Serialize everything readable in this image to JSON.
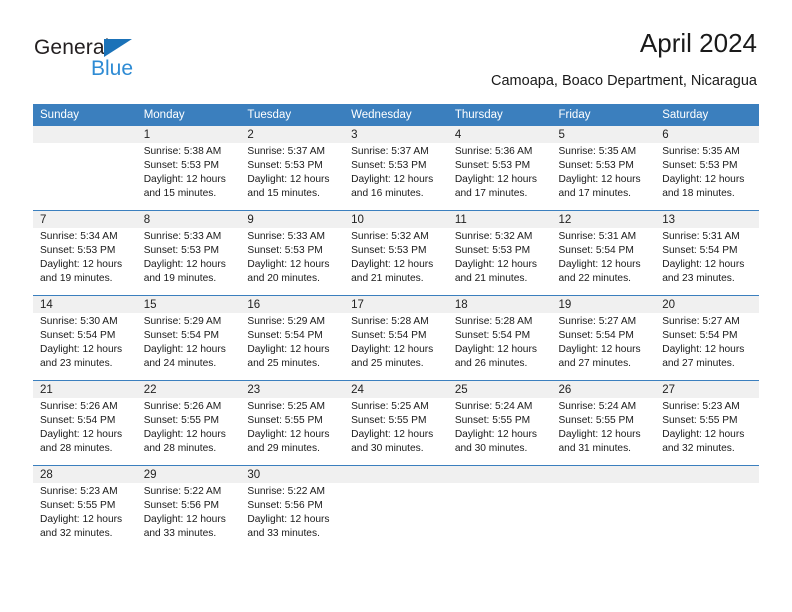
{
  "brand": {
    "name_part1": "General",
    "name_part2": "Blue",
    "triangle_icon": "triangle-icon",
    "accent_dark": "#1b72b8",
    "accent_light": "#2e8bd4"
  },
  "header": {
    "title": "April 2024",
    "subtitle": "Camoapa, Boaco Department, Nicaragua"
  },
  "colors": {
    "header_row_bg": "#3b7fbe",
    "daynum_bg": "#f0f0f0",
    "grid_line": "#3b7fbe",
    "text": "#1a1a1a"
  },
  "calendar": {
    "weekday_headers": [
      "Sunday",
      "Monday",
      "Tuesday",
      "Wednesday",
      "Thursday",
      "Friday",
      "Saturday"
    ],
    "weeks": [
      [
        {
          "day": "",
          "sunrise": "",
          "sunset": "",
          "daylight1": "",
          "daylight2": ""
        },
        {
          "day": "1",
          "sunrise": "Sunrise: 5:38 AM",
          "sunset": "Sunset: 5:53 PM",
          "daylight1": "Daylight: 12 hours",
          "daylight2": "and 15 minutes."
        },
        {
          "day": "2",
          "sunrise": "Sunrise: 5:37 AM",
          "sunset": "Sunset: 5:53 PM",
          "daylight1": "Daylight: 12 hours",
          "daylight2": "and 15 minutes."
        },
        {
          "day": "3",
          "sunrise": "Sunrise: 5:37 AM",
          "sunset": "Sunset: 5:53 PM",
          "daylight1": "Daylight: 12 hours",
          "daylight2": "and 16 minutes."
        },
        {
          "day": "4",
          "sunrise": "Sunrise: 5:36 AM",
          "sunset": "Sunset: 5:53 PM",
          "daylight1": "Daylight: 12 hours",
          "daylight2": "and 17 minutes."
        },
        {
          "day": "5",
          "sunrise": "Sunrise: 5:35 AM",
          "sunset": "Sunset: 5:53 PM",
          "daylight1": "Daylight: 12 hours",
          "daylight2": "and 17 minutes."
        },
        {
          "day": "6",
          "sunrise": "Sunrise: 5:35 AM",
          "sunset": "Sunset: 5:53 PM",
          "daylight1": "Daylight: 12 hours",
          "daylight2": "and 18 minutes."
        }
      ],
      [
        {
          "day": "7",
          "sunrise": "Sunrise: 5:34 AM",
          "sunset": "Sunset: 5:53 PM",
          "daylight1": "Daylight: 12 hours",
          "daylight2": "and 19 minutes."
        },
        {
          "day": "8",
          "sunrise": "Sunrise: 5:33 AM",
          "sunset": "Sunset: 5:53 PM",
          "daylight1": "Daylight: 12 hours",
          "daylight2": "and 19 minutes."
        },
        {
          "day": "9",
          "sunrise": "Sunrise: 5:33 AM",
          "sunset": "Sunset: 5:53 PM",
          "daylight1": "Daylight: 12 hours",
          "daylight2": "and 20 minutes."
        },
        {
          "day": "10",
          "sunrise": "Sunrise: 5:32 AM",
          "sunset": "Sunset: 5:53 PM",
          "daylight1": "Daylight: 12 hours",
          "daylight2": "and 21 minutes."
        },
        {
          "day": "11",
          "sunrise": "Sunrise: 5:32 AM",
          "sunset": "Sunset: 5:53 PM",
          "daylight1": "Daylight: 12 hours",
          "daylight2": "and 21 minutes."
        },
        {
          "day": "12",
          "sunrise": "Sunrise: 5:31 AM",
          "sunset": "Sunset: 5:54 PM",
          "daylight1": "Daylight: 12 hours",
          "daylight2": "and 22 minutes."
        },
        {
          "day": "13",
          "sunrise": "Sunrise: 5:31 AM",
          "sunset": "Sunset: 5:54 PM",
          "daylight1": "Daylight: 12 hours",
          "daylight2": "and 23 minutes."
        }
      ],
      [
        {
          "day": "14",
          "sunrise": "Sunrise: 5:30 AM",
          "sunset": "Sunset: 5:54 PM",
          "daylight1": "Daylight: 12 hours",
          "daylight2": "and 23 minutes."
        },
        {
          "day": "15",
          "sunrise": "Sunrise: 5:29 AM",
          "sunset": "Sunset: 5:54 PM",
          "daylight1": "Daylight: 12 hours",
          "daylight2": "and 24 minutes."
        },
        {
          "day": "16",
          "sunrise": "Sunrise: 5:29 AM",
          "sunset": "Sunset: 5:54 PM",
          "daylight1": "Daylight: 12 hours",
          "daylight2": "and 25 minutes."
        },
        {
          "day": "17",
          "sunrise": "Sunrise: 5:28 AM",
          "sunset": "Sunset: 5:54 PM",
          "daylight1": "Daylight: 12 hours",
          "daylight2": "and 25 minutes."
        },
        {
          "day": "18",
          "sunrise": "Sunrise: 5:28 AM",
          "sunset": "Sunset: 5:54 PM",
          "daylight1": "Daylight: 12 hours",
          "daylight2": "and 26 minutes."
        },
        {
          "day": "19",
          "sunrise": "Sunrise: 5:27 AM",
          "sunset": "Sunset: 5:54 PM",
          "daylight1": "Daylight: 12 hours",
          "daylight2": "and 27 minutes."
        },
        {
          "day": "20",
          "sunrise": "Sunrise: 5:27 AM",
          "sunset": "Sunset: 5:54 PM",
          "daylight1": "Daylight: 12 hours",
          "daylight2": "and 27 minutes."
        }
      ],
      [
        {
          "day": "21",
          "sunrise": "Sunrise: 5:26 AM",
          "sunset": "Sunset: 5:54 PM",
          "daylight1": "Daylight: 12 hours",
          "daylight2": "and 28 minutes."
        },
        {
          "day": "22",
          "sunrise": "Sunrise: 5:26 AM",
          "sunset": "Sunset: 5:55 PM",
          "daylight1": "Daylight: 12 hours",
          "daylight2": "and 28 minutes."
        },
        {
          "day": "23",
          "sunrise": "Sunrise: 5:25 AM",
          "sunset": "Sunset: 5:55 PM",
          "daylight1": "Daylight: 12 hours",
          "daylight2": "and 29 minutes."
        },
        {
          "day": "24",
          "sunrise": "Sunrise: 5:25 AM",
          "sunset": "Sunset: 5:55 PM",
          "daylight1": "Daylight: 12 hours",
          "daylight2": "and 30 minutes."
        },
        {
          "day": "25",
          "sunrise": "Sunrise: 5:24 AM",
          "sunset": "Sunset: 5:55 PM",
          "daylight1": "Daylight: 12 hours",
          "daylight2": "and 30 minutes."
        },
        {
          "day": "26",
          "sunrise": "Sunrise: 5:24 AM",
          "sunset": "Sunset: 5:55 PM",
          "daylight1": "Daylight: 12 hours",
          "daylight2": "and 31 minutes."
        },
        {
          "day": "27",
          "sunrise": "Sunrise: 5:23 AM",
          "sunset": "Sunset: 5:55 PM",
          "daylight1": "Daylight: 12 hours",
          "daylight2": "and 32 minutes."
        }
      ],
      [
        {
          "day": "28",
          "sunrise": "Sunrise: 5:23 AM",
          "sunset": "Sunset: 5:55 PM",
          "daylight1": "Daylight: 12 hours",
          "daylight2": "and 32 minutes."
        },
        {
          "day": "29",
          "sunrise": "Sunrise: 5:22 AM",
          "sunset": "Sunset: 5:56 PM",
          "daylight1": "Daylight: 12 hours",
          "daylight2": "and 33 minutes."
        },
        {
          "day": "30",
          "sunrise": "Sunrise: 5:22 AM",
          "sunset": "Sunset: 5:56 PM",
          "daylight1": "Daylight: 12 hours",
          "daylight2": "and 33 minutes."
        },
        {
          "day": "",
          "sunrise": "",
          "sunset": "",
          "daylight1": "",
          "daylight2": ""
        },
        {
          "day": "",
          "sunrise": "",
          "sunset": "",
          "daylight1": "",
          "daylight2": ""
        },
        {
          "day": "",
          "sunrise": "",
          "sunset": "",
          "daylight1": "",
          "daylight2": ""
        },
        {
          "day": "",
          "sunrise": "",
          "sunset": "",
          "daylight1": "",
          "daylight2": ""
        }
      ]
    ]
  }
}
